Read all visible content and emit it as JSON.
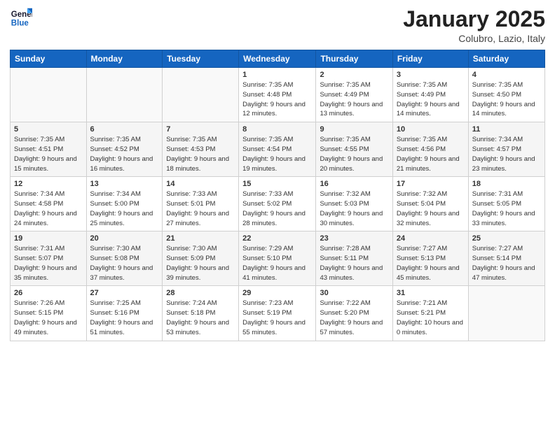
{
  "logo": {
    "line1": "General",
    "line2": "Blue"
  },
  "title": "January 2025",
  "subtitle": "Colubro, Lazio, Italy",
  "days_of_week": [
    "Sunday",
    "Monday",
    "Tuesday",
    "Wednesday",
    "Thursday",
    "Friday",
    "Saturday"
  ],
  "weeks": [
    [
      {
        "day": "",
        "sunrise": "",
        "sunset": "",
        "daylight": ""
      },
      {
        "day": "",
        "sunrise": "",
        "sunset": "",
        "daylight": ""
      },
      {
        "day": "",
        "sunrise": "",
        "sunset": "",
        "daylight": ""
      },
      {
        "day": "1",
        "sunrise": "Sunrise: 7:35 AM",
        "sunset": "Sunset: 4:48 PM",
        "daylight": "Daylight: 9 hours and 12 minutes."
      },
      {
        "day": "2",
        "sunrise": "Sunrise: 7:35 AM",
        "sunset": "Sunset: 4:49 PM",
        "daylight": "Daylight: 9 hours and 13 minutes."
      },
      {
        "day": "3",
        "sunrise": "Sunrise: 7:35 AM",
        "sunset": "Sunset: 4:49 PM",
        "daylight": "Daylight: 9 hours and 14 minutes."
      },
      {
        "day": "4",
        "sunrise": "Sunrise: 7:35 AM",
        "sunset": "Sunset: 4:50 PM",
        "daylight": "Daylight: 9 hours and 14 minutes."
      }
    ],
    [
      {
        "day": "5",
        "sunrise": "Sunrise: 7:35 AM",
        "sunset": "Sunset: 4:51 PM",
        "daylight": "Daylight: 9 hours and 15 minutes."
      },
      {
        "day": "6",
        "sunrise": "Sunrise: 7:35 AM",
        "sunset": "Sunset: 4:52 PM",
        "daylight": "Daylight: 9 hours and 16 minutes."
      },
      {
        "day": "7",
        "sunrise": "Sunrise: 7:35 AM",
        "sunset": "Sunset: 4:53 PM",
        "daylight": "Daylight: 9 hours and 18 minutes."
      },
      {
        "day": "8",
        "sunrise": "Sunrise: 7:35 AM",
        "sunset": "Sunset: 4:54 PM",
        "daylight": "Daylight: 9 hours and 19 minutes."
      },
      {
        "day": "9",
        "sunrise": "Sunrise: 7:35 AM",
        "sunset": "Sunset: 4:55 PM",
        "daylight": "Daylight: 9 hours and 20 minutes."
      },
      {
        "day": "10",
        "sunrise": "Sunrise: 7:35 AM",
        "sunset": "Sunset: 4:56 PM",
        "daylight": "Daylight: 9 hours and 21 minutes."
      },
      {
        "day": "11",
        "sunrise": "Sunrise: 7:34 AM",
        "sunset": "Sunset: 4:57 PM",
        "daylight": "Daylight: 9 hours and 23 minutes."
      }
    ],
    [
      {
        "day": "12",
        "sunrise": "Sunrise: 7:34 AM",
        "sunset": "Sunset: 4:58 PM",
        "daylight": "Daylight: 9 hours and 24 minutes."
      },
      {
        "day": "13",
        "sunrise": "Sunrise: 7:34 AM",
        "sunset": "Sunset: 5:00 PM",
        "daylight": "Daylight: 9 hours and 25 minutes."
      },
      {
        "day": "14",
        "sunrise": "Sunrise: 7:33 AM",
        "sunset": "Sunset: 5:01 PM",
        "daylight": "Daylight: 9 hours and 27 minutes."
      },
      {
        "day": "15",
        "sunrise": "Sunrise: 7:33 AM",
        "sunset": "Sunset: 5:02 PM",
        "daylight": "Daylight: 9 hours and 28 minutes."
      },
      {
        "day": "16",
        "sunrise": "Sunrise: 7:32 AM",
        "sunset": "Sunset: 5:03 PM",
        "daylight": "Daylight: 9 hours and 30 minutes."
      },
      {
        "day": "17",
        "sunrise": "Sunrise: 7:32 AM",
        "sunset": "Sunset: 5:04 PM",
        "daylight": "Daylight: 9 hours and 32 minutes."
      },
      {
        "day": "18",
        "sunrise": "Sunrise: 7:31 AM",
        "sunset": "Sunset: 5:05 PM",
        "daylight": "Daylight: 9 hours and 33 minutes."
      }
    ],
    [
      {
        "day": "19",
        "sunrise": "Sunrise: 7:31 AM",
        "sunset": "Sunset: 5:07 PM",
        "daylight": "Daylight: 9 hours and 35 minutes."
      },
      {
        "day": "20",
        "sunrise": "Sunrise: 7:30 AM",
        "sunset": "Sunset: 5:08 PM",
        "daylight": "Daylight: 9 hours and 37 minutes."
      },
      {
        "day": "21",
        "sunrise": "Sunrise: 7:30 AM",
        "sunset": "Sunset: 5:09 PM",
        "daylight": "Daylight: 9 hours and 39 minutes."
      },
      {
        "day": "22",
        "sunrise": "Sunrise: 7:29 AM",
        "sunset": "Sunset: 5:10 PM",
        "daylight": "Daylight: 9 hours and 41 minutes."
      },
      {
        "day": "23",
        "sunrise": "Sunrise: 7:28 AM",
        "sunset": "Sunset: 5:11 PM",
        "daylight": "Daylight: 9 hours and 43 minutes."
      },
      {
        "day": "24",
        "sunrise": "Sunrise: 7:27 AM",
        "sunset": "Sunset: 5:13 PM",
        "daylight": "Daylight: 9 hours and 45 minutes."
      },
      {
        "day": "25",
        "sunrise": "Sunrise: 7:27 AM",
        "sunset": "Sunset: 5:14 PM",
        "daylight": "Daylight: 9 hours and 47 minutes."
      }
    ],
    [
      {
        "day": "26",
        "sunrise": "Sunrise: 7:26 AM",
        "sunset": "Sunset: 5:15 PM",
        "daylight": "Daylight: 9 hours and 49 minutes."
      },
      {
        "day": "27",
        "sunrise": "Sunrise: 7:25 AM",
        "sunset": "Sunset: 5:16 PM",
        "daylight": "Daylight: 9 hours and 51 minutes."
      },
      {
        "day": "28",
        "sunrise": "Sunrise: 7:24 AM",
        "sunset": "Sunset: 5:18 PM",
        "daylight": "Daylight: 9 hours and 53 minutes."
      },
      {
        "day": "29",
        "sunrise": "Sunrise: 7:23 AM",
        "sunset": "Sunset: 5:19 PM",
        "daylight": "Daylight: 9 hours and 55 minutes."
      },
      {
        "day": "30",
        "sunrise": "Sunrise: 7:22 AM",
        "sunset": "Sunset: 5:20 PM",
        "daylight": "Daylight: 9 hours and 57 minutes."
      },
      {
        "day": "31",
        "sunrise": "Sunrise: 7:21 AM",
        "sunset": "Sunset: 5:21 PM",
        "daylight": "Daylight: 10 hours and 0 minutes."
      },
      {
        "day": "",
        "sunrise": "",
        "sunset": "",
        "daylight": ""
      }
    ]
  ]
}
